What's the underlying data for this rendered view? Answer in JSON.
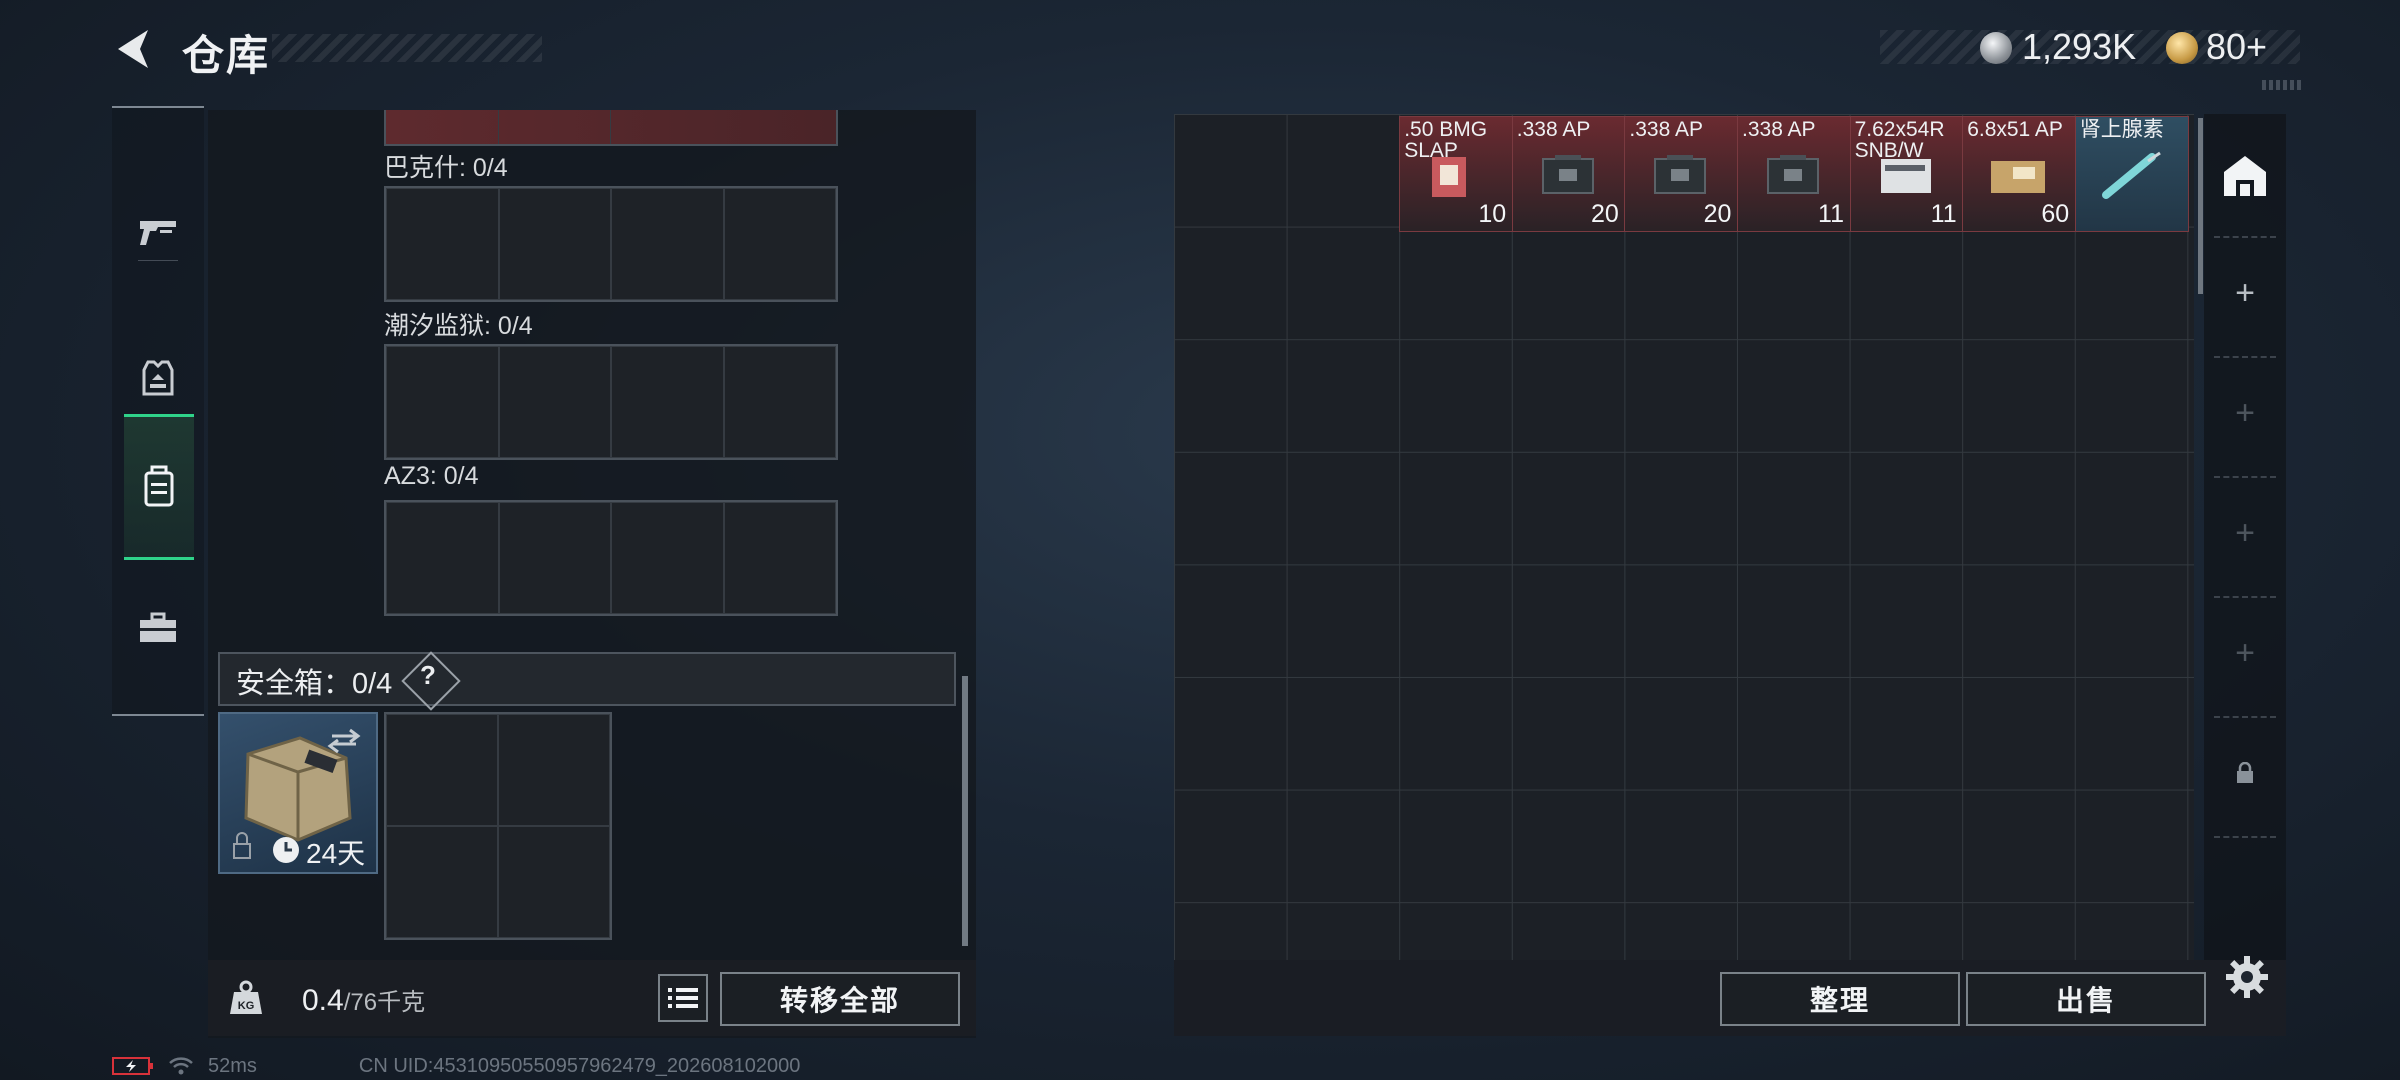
{
  "header": {
    "title": "仓库"
  },
  "currency": {
    "silver": "1,293K",
    "gold": "80+"
  },
  "left_tabs": [
    {
      "name": "weapon",
      "active": false
    },
    {
      "name": "armor",
      "active": false
    },
    {
      "name": "backpack",
      "active": true
    },
    {
      "name": "toolbox",
      "active": false
    }
  ],
  "containers": [
    {
      "label": "巴克什: 0/4"
    },
    {
      "label": "潮汐监狱: 0/4"
    },
    {
      "label": "AZ3: 0/4"
    }
  ],
  "safe_box": {
    "label": "安全箱：0/4",
    "help": "?",
    "duration": "24天"
  },
  "weight": {
    "value": "0.4",
    "capacity": "/76千克",
    "badge": "KG"
  },
  "buttons": {
    "transfer_all": "转移全部",
    "organize": "整理",
    "sell": "出售"
  },
  "stash_items": [
    {
      "name": ".50 BMG SLAP",
      "count": "10",
      "color": "#6a2a30"
    },
    {
      "name": ".338 AP",
      "count": "20",
      "color": "#6a2a30"
    },
    {
      "name": ".338 AP",
      "count": "20",
      "color": "#6a2a30"
    },
    {
      "name": ".338 AP",
      "count": "11",
      "color": "#6a2a30"
    },
    {
      "name": "7.62x54R SNB/W",
      "count": "11",
      "color": "#6a2a30"
    },
    {
      "name": "6.8x51 AP",
      "count": "60",
      "color": "#6a2a30"
    },
    {
      "name": "肾上腺素",
      "count": "",
      "color": "#2c4a5e"
    }
  ],
  "status": {
    "ping": "52ms",
    "uid": "CN UID:45310950550957962479_202608102000"
  }
}
